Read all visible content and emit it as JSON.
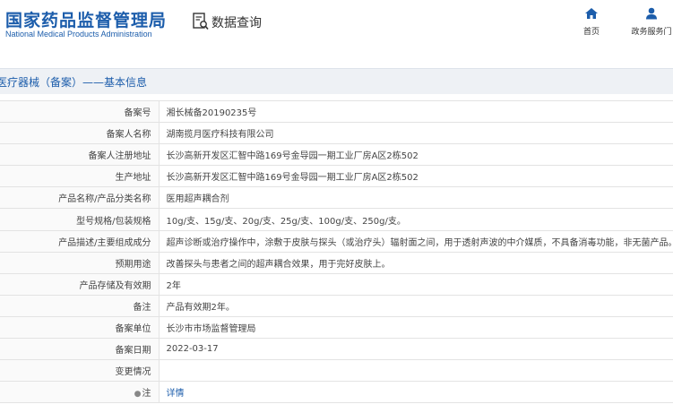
{
  "header": {
    "brand_cn": "国家药品监督管理局",
    "brand_en": "National Medical Products Administration",
    "query_label": "数据查询",
    "nav": [
      {
        "label": "首页",
        "icon": "home-icon"
      },
      {
        "label": "政务服务门",
        "icon": "user-icon"
      }
    ]
  },
  "section": {
    "title": "医疗器械（备案）——基本信息"
  },
  "rows": [
    {
      "label": "备案号",
      "value": "湘长械备20190235号"
    },
    {
      "label": "备案人名称",
      "value": "湖南揽月医疗科技有限公司"
    },
    {
      "label": "备案人注册地址",
      "value": "长沙高新开发区汇智中路169号金导园一期工业厂房A区2栋502"
    },
    {
      "label": "生产地址",
      "value": "长沙高新开发区汇智中路169号金导园一期工业厂房A区2栋502"
    },
    {
      "label": "产品名称/产品分类名称",
      "value": "医用超声耦合剂"
    },
    {
      "label": "型号规格/包装规格",
      "value": "10g/支、15g/支、20g/支、25g/支、100g/支、250g/支。"
    },
    {
      "label": "产品描述/主要组成成分",
      "value": "超声诊断或治疗操作中，涂敷于皮肤与探头（或治疗头）辐射面之间，用于透射声波的中介媒质，不具备消毒功能，非无菌产品。"
    },
    {
      "label": "预期用途",
      "value": "改善探头与患者之间的超声耦合效果，用于完好皮肤上。"
    },
    {
      "label": "产品存储及有效期",
      "value": "2年"
    },
    {
      "label": "备注",
      "value": "产品有效期2年。"
    },
    {
      "label": "备案单位",
      "value": "长沙市市场监督管理局"
    },
    {
      "label": "备案日期",
      "value": "2022-03-17"
    },
    {
      "label": "变更情况",
      "value": ""
    }
  ],
  "note": {
    "label": "注",
    "link": "详情",
    "icon": "pin-icon"
  },
  "colors": {
    "brand": "#1c5dab",
    "section_bg": "#eef1f5"
  }
}
